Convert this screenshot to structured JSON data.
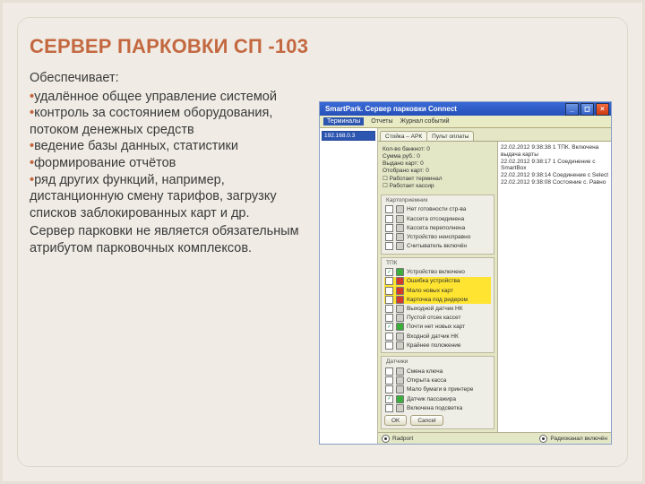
{
  "slide": {
    "title": "СЕРВЕР ПАРКОВКИ СП -103",
    "lead": "Обеспечивает:",
    "bullet_glyph": "•",
    "bullets": [
      "удалённое общее управление системой",
      "контроль за состоянием оборудования, потоком денежных средств",
      "ведение базы данных, статистики",
      "формирование отчётов",
      "ряд других функций, например, дистанционную смену тарифов, загрузку списков заблокированных карт и др."
    ],
    "tail": "Сервер парковки не является обязательным атрибутом парковочных комплексов."
  },
  "app": {
    "title": "SmartPark. Сервер парковки Connect",
    "menus": [
      "Терминалы",
      "Отчеты",
      "Журнал событий"
    ],
    "tree_root": "192.168.0.3",
    "tabs": [
      "Стойка – АРК",
      "Пульт оплаты"
    ],
    "statsLines": [
      "Кол-во банкнот: 0",
      "Сумма руб.: 0",
      "Выдано карт: 0",
      "Отобрано карт: 0",
      "☐ Работает терминал",
      "☐ Работает кассир"
    ],
    "log": [
      "22.02.2012 9:38:38    1  ТПК. Включена выдача карты",
      "22.02.2012 9:38:17    1  Соединение с SmartBox",
      "22.02.2012 9:38:14    Соединение с Select",
      "22.02.2012 9:38:08    Состояние с. Равно"
    ],
    "group1": {
      "title": "Картоприемник",
      "items": [
        {
          "led": "gray",
          "label": "Нет готовности стр-ва"
        },
        {
          "led": "gray",
          "label": "Кассета отсоединена"
        },
        {
          "led": "gray",
          "label": "Кассета переполнена"
        },
        {
          "led": "gray",
          "label": "Устройство неисправно"
        },
        {
          "led": "gray",
          "label": "Считыватель включён"
        }
      ]
    },
    "group2": {
      "title": "ТПК",
      "items": [
        {
          "led": "green",
          "checked": true,
          "label": "Устройство включено"
        },
        {
          "led": "red",
          "label": "Ошибка устройства",
          "hl": true
        },
        {
          "led": "red",
          "label": "Мало новых карт",
          "hl": true
        },
        {
          "led": "red",
          "label": "Карточка под ридером",
          "hl": true
        },
        {
          "led": "gray",
          "label": "Выходной датчик НК"
        },
        {
          "led": "gray",
          "label": "Пустой отсек кассет"
        },
        {
          "led": "green",
          "checked": true,
          "label": "Почти нет новых карт"
        },
        {
          "led": "gray",
          "label": "Входной датчик НК"
        },
        {
          "led": "gray",
          "label": "Крайнее положение"
        }
      ]
    },
    "group3": {
      "title": "Датчики",
      "items": [
        {
          "led": "gray",
          "label": "Смена ключа"
        },
        {
          "led": "gray",
          "label": "Открыта касса"
        },
        {
          "led": "gray",
          "label": "Мало бумаги в принтере"
        },
        {
          "led": "green",
          "checked": true,
          "label": "Датчик пассажира"
        },
        {
          "led": "gray",
          "label": "Включена подсветка"
        }
      ]
    },
    "buttons": [
      "OK",
      "Cancel"
    ],
    "status": {
      "left": "Radport",
      "right": "Радиоканал включён"
    }
  }
}
